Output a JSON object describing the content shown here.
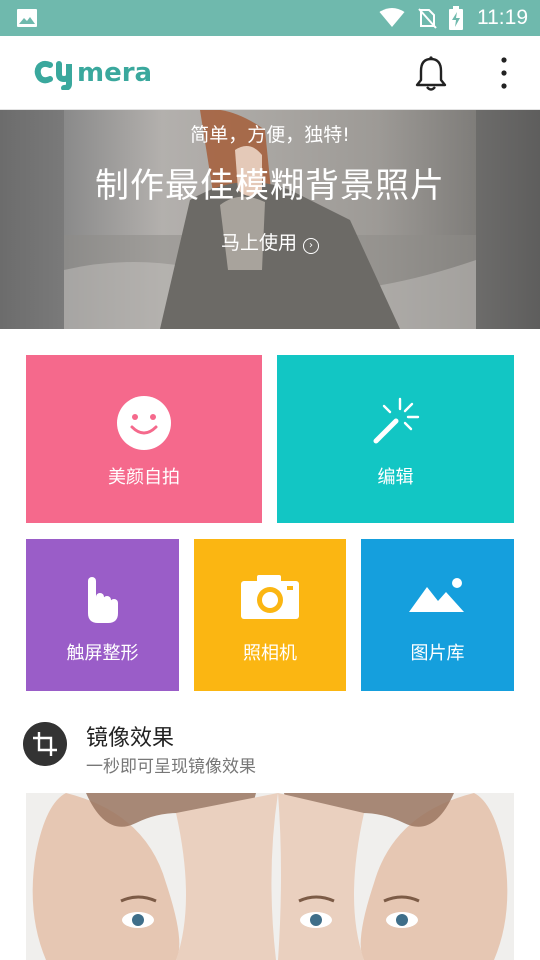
{
  "status_bar": {
    "time": "11:19",
    "icons": [
      "gallery-icon",
      "wifi-icon",
      "no-sim-icon",
      "battery-charging-icon"
    ]
  },
  "app_bar": {
    "logo_text": "cymera",
    "icons": [
      "bell-icon",
      "more-vert-icon"
    ]
  },
  "banner": {
    "subtitle": "简单，方便，独特!",
    "title": "制作最佳模糊背景照片",
    "cta": "马上使用",
    "cta_arrow": "›"
  },
  "tiles": {
    "selfie": {
      "label": "美颜自拍",
      "icon": "smiley-icon",
      "color": "#f5698c"
    },
    "edit": {
      "label": "编辑",
      "icon": "magic-wand-icon",
      "color": "#12c6c4"
    },
    "touch": {
      "label": "触屏整形",
      "icon": "hand-pointer-icon",
      "color": "#9a5dc8"
    },
    "camera": {
      "label": "照相机",
      "icon": "camera-icon",
      "color": "#fbb612"
    },
    "gallery": {
      "label": "图片库",
      "icon": "landscape-icon",
      "color": "#159fdd"
    }
  },
  "mirror_section": {
    "title": "镜像效果",
    "subtitle": "一秒即可呈现镜像效果",
    "icon": "crop-icon"
  },
  "colors": {
    "status_bar": "#6fb9ad",
    "logo": "#3aa89d"
  }
}
